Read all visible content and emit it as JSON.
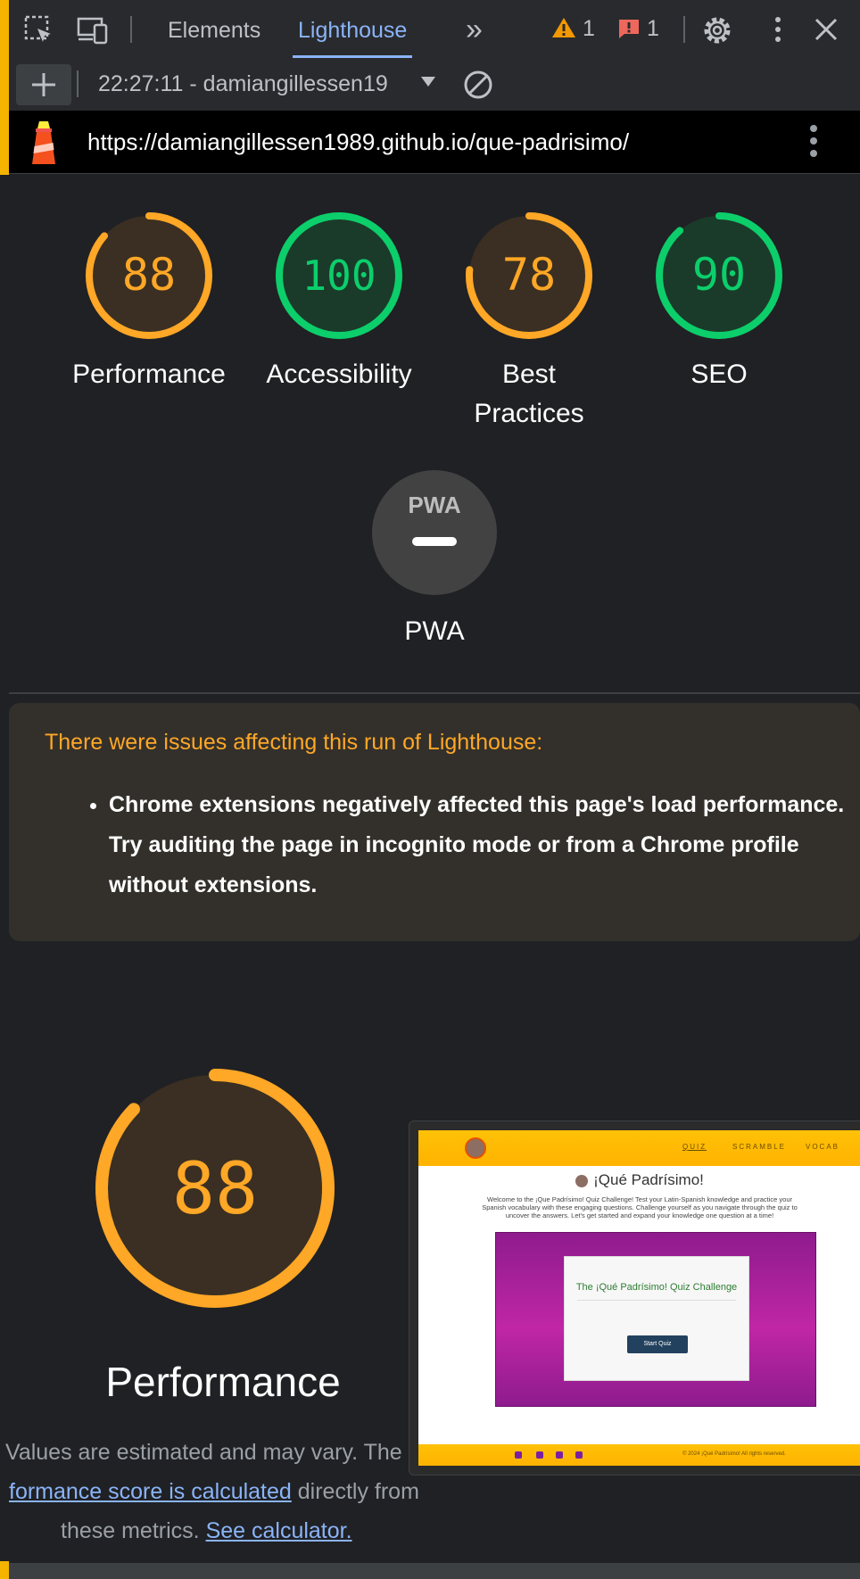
{
  "toolbar": {
    "tabs": [
      "Elements",
      "Lighthouse"
    ],
    "active_tab": "Lighthouse",
    "more_tabs_glyph": "»",
    "warnings_count": "1",
    "errors_count": "1"
  },
  "run": {
    "label": "22:27:11 - damiangillessen19",
    "url": "https://damiangillessen1989.github.io/que-padrisimo/"
  },
  "scores": [
    {
      "label": "Performance",
      "score": 88,
      "score_text": "88",
      "color": "#ffa726"
    },
    {
      "label": "Accessibility",
      "score": 100,
      "score_text": "100",
      "color": "#0cce6b"
    },
    {
      "label_line1": "Best",
      "label_line2": "Practices",
      "score": 78,
      "score_text": "78",
      "color": "#ffa726"
    },
    {
      "label": "SEO",
      "score": 90,
      "score_text": "90",
      "color": "#0cce6b"
    }
  ],
  "pwa": {
    "label": "PWA",
    "badge": "PWA"
  },
  "warning": {
    "title": "There were issues affecting this run of Lighthouse:",
    "items": [
      "Chrome extensions negatively affected this page's load performance. Try auditing the page in incognito mode or from a Chrome profile without extensions."
    ]
  },
  "performance": {
    "score": 88,
    "score_text": "88",
    "label": "Performance",
    "note_line1": "Values are estimated and may vary. The",
    "note_link1": "formance score is calculated",
    "note_line2_rest": " directly from",
    "note_line3": "these metrics. ",
    "note_link2": "See calculator."
  },
  "thumbnail": {
    "nav": [
      "QUIZ",
      "SCRAMBLE",
      "VOCAB"
    ],
    "title": "¡Qué Padrísimo!",
    "description": "Welcome to the ¡Que Padrísimo! Quiz Challenge! Test your Latin-Spanish knowledge and practice your Spanish vocabulary with these engaging questions. Challenge yourself as you navigate through the quiz to uncover the answers. Let's get started and expand your knowledge one question at a time!",
    "card_title": "The ¡Qué Padrísimo! Quiz Challenge",
    "button": "Start Quiz",
    "copyright": "© 2024 ¡Qué Padrísimo! All rights reserved."
  },
  "colors": {
    "average": "#ffa726",
    "pass": "#0cce6b",
    "link": "#8ab4f8"
  }
}
